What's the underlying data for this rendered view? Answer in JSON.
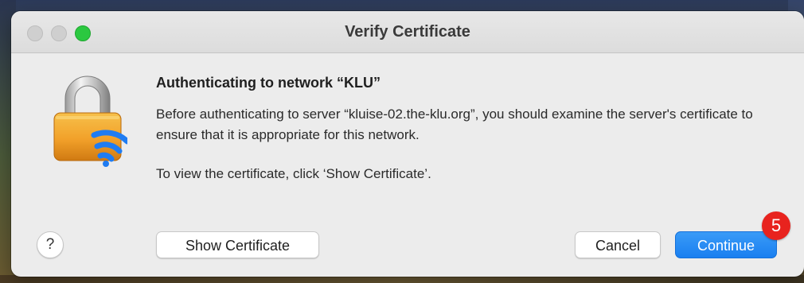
{
  "window": {
    "title": "Verify Certificate"
  },
  "dialog": {
    "heading": "Authenticating to network “KLU”",
    "message": "Before authenticating to server “kluise-02.the-klu.org”, you should examine the server's certificate to ensure that it is appropriate for this network.",
    "instruction": "To view the certificate, click ‘Show Certificate’."
  },
  "buttons": {
    "help": "?",
    "show_certificate": "Show Certificate",
    "cancel": "Cancel",
    "continue": "Continue"
  },
  "badge": {
    "count": "5"
  },
  "icons": {
    "dialog_icon": "lock-wifi-icon"
  },
  "colors": {
    "accent": "#1a7ff0",
    "badge": "#e8231e",
    "traffic_max": "#2bc840",
    "wifi_waves": "#1f7cf2",
    "lock_body": "#f2a12a"
  }
}
